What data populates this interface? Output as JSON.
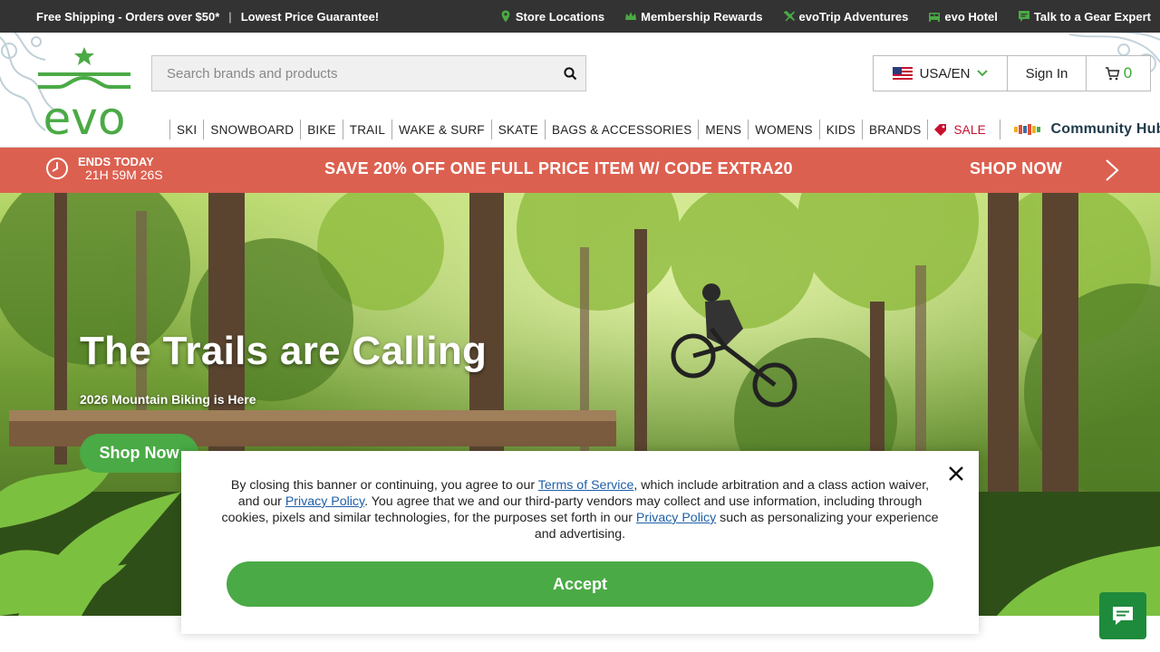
{
  "utility_bar": {
    "shipping": "Free Shipping - Orders over $50*",
    "separator": "|",
    "price_guarantee": "Lowest Price Guarantee!",
    "links": {
      "store_locations": "Store Locations",
      "membership": "Membership Rewards",
      "evotrip": "evoTrip Adventures",
      "hotel": "evo Hotel",
      "gear_expert": "Talk to a Gear Expert"
    },
    "icon_color": "#4aaa45"
  },
  "header": {
    "logo_text": "evo",
    "search": {
      "placeholder": "Search brands and products"
    },
    "locale": "USA/EN",
    "sign_in": "Sign In",
    "cart_count": "0"
  },
  "nav": {
    "items": [
      "SKI",
      "SNOWBOARD",
      "BIKE",
      "TRAIL",
      "WAKE & SURF",
      "SKATE",
      "BAGS & ACCESSORIES",
      "MENS",
      "WOMENS",
      "KIDS",
      "BRANDS"
    ],
    "sale": "SALE",
    "community": "Community Hub"
  },
  "promo": {
    "ends": "ENDS TODAY",
    "countdown": "21H 59M 26S",
    "message": "SAVE 20% OFF ONE FULL PRICE ITEM W/ CODE EXTRA20",
    "cta": "SHOP NOW",
    "background": "#dc6050"
  },
  "hero": {
    "title": "The Trails are Calling",
    "subtitle": "2026 Mountain Biking is Here",
    "cta": "Shop Now"
  },
  "cookie_banner": {
    "text_1": "By closing this banner or continuing, you agree to our ",
    "terms_link": "Terms of Service",
    "text_2": ", which include arbitration and a class action waiver, and our ",
    "privacy_link_1": "Privacy Policy",
    "text_3": ". You agree that we and our third-party vendors may collect and use information, including through cookies, pixels and similar technologies, for the purposes set forth in our ",
    "privacy_link_2": "Privacy Policy",
    "text_4": " such as personalizing your experience and advertising.",
    "accept": "Accept"
  },
  "brand_green": "#4aaa45"
}
